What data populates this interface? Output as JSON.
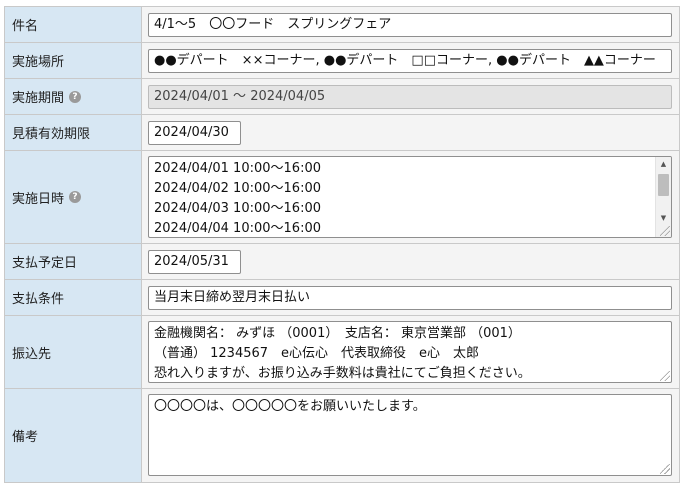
{
  "form": {
    "subject": {
      "label": "件名",
      "value": "4/1～5　〇〇フード　スプリングフェア"
    },
    "location": {
      "label": "実施場所",
      "value": "●●デパート　××コーナー, ●●デパート　□□コーナー, ●●デパート　▲▲コーナー"
    },
    "period": {
      "label": "実施期間",
      "value": "2024/04/01 ～ 2024/04/05"
    },
    "estimate_expiry": {
      "label": "見積有効期限",
      "value": "2024/04/30"
    },
    "datetimes": {
      "label": "実施日時",
      "lines": [
        "2024/04/01 10:00～16:00",
        "2024/04/02 10:00～16:00",
        "2024/04/03 10:00～16:00",
        "2024/04/04 10:00～16:00"
      ]
    },
    "payment_date": {
      "label": "支払予定日",
      "value": "2024/05/31"
    },
    "payment_terms": {
      "label": "支払条件",
      "value": "当月末日締め翌月末日払い"
    },
    "bank": {
      "label": "振込先",
      "lines": [
        "金融機関名： みずほ （0001）　支店名： 東京営業部 （001）",
        "（普通） 1234567　e心伝心　代表取締役　e心　太郎",
        "恐れ入りますが、お振り込み手数料は貴社にてご負担ください。"
      ]
    },
    "remarks": {
      "label": "備考",
      "lines": [
        "〇〇〇〇は、〇〇〇〇〇をお願いいたします。"
      ]
    }
  },
  "icons": {
    "help": "question-circle-icon",
    "scroll_up": "triangle-up-icon",
    "scroll_down": "triangle-down-icon"
  }
}
